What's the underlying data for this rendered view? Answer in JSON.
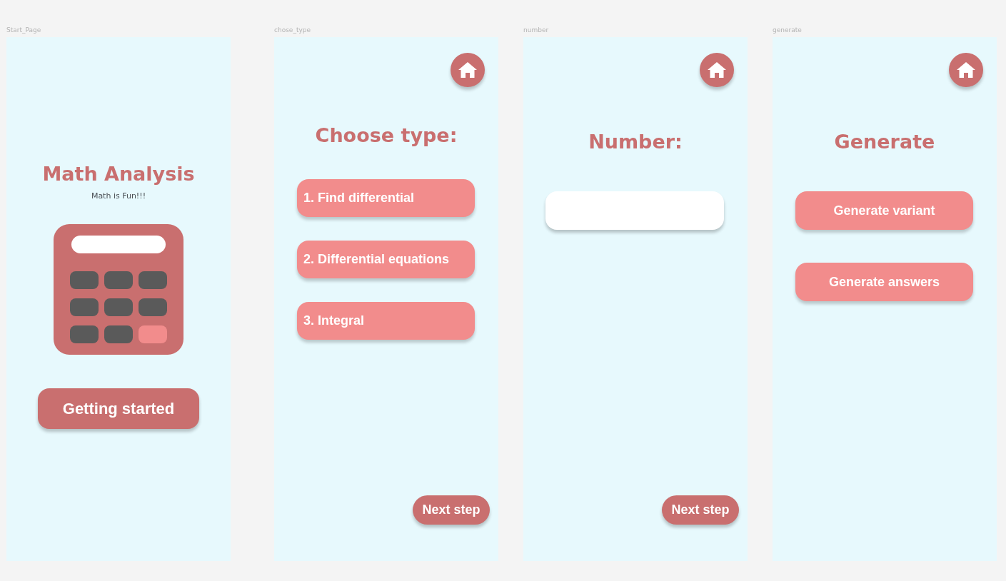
{
  "canvas": {
    "frames": [
      {
        "kind": "start",
        "label": "Start_Page",
        "title": "Math Analysis",
        "subtitle": "Math is Fun!!!",
        "button": "Getting started"
      },
      {
        "kind": "choose",
        "label": "chose_type",
        "title": "Choose type:",
        "options": [
          "1. Find differential",
          "2. Differential equations",
          "3. Integral"
        ],
        "next_button": "Next step"
      },
      {
        "kind": "number",
        "label": "number",
        "title": "Number:",
        "next_button": "Next step"
      },
      {
        "kind": "generate",
        "label": "generate",
        "title": "Generate",
        "buttons": [
          "Generate variant",
          "Generate answers"
        ]
      }
    ]
  }
}
